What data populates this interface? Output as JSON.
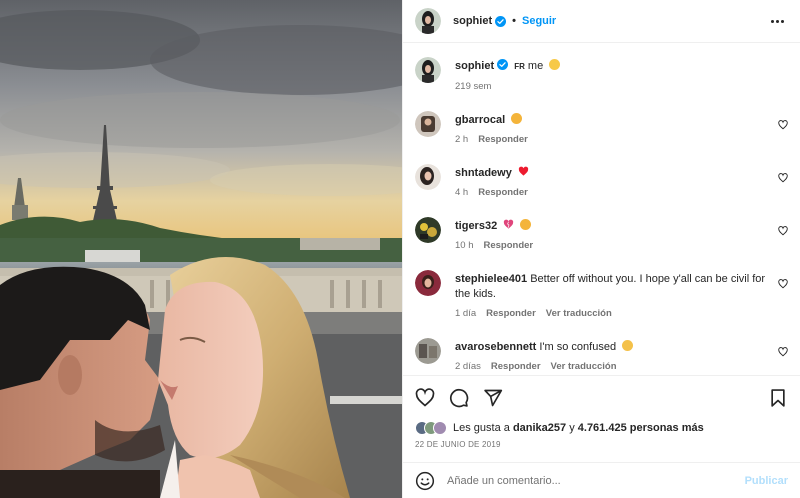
{
  "post": {
    "author": "sophiet",
    "follow_label": "Seguir",
    "dot": "•",
    "caption_flag": "FR",
    "caption_text": "me",
    "caption_time": "219 sem"
  },
  "comments": [
    {
      "user": "gbarrocal",
      "text": "",
      "time": "2 h",
      "reply": "Responder",
      "translate": ""
    },
    {
      "user": "shntadewy",
      "text": "",
      "time": "4 h",
      "reply": "Responder",
      "translate": ""
    },
    {
      "user": "tigers32",
      "text": "",
      "time": "10 h",
      "reply": "Responder",
      "translate": ""
    },
    {
      "user": "stephielee401",
      "text": "Better off without you. I hope y'all can be civil for the kids.",
      "time": "1 día",
      "reply": "Responder",
      "translate": "Ver traducción"
    },
    {
      "user": "avarosebennett",
      "text": "I'm so confused",
      "time": "2 días",
      "reply": "Responder",
      "translate": "Ver traducción"
    }
  ],
  "likes": {
    "prefix": "Les gusta a",
    "user": "danika257",
    "connector": "y",
    "others": "4.761.425 personas más"
  },
  "date": "22 DE JUNIO DE 2019",
  "composer": {
    "placeholder": "Añade un comentario...",
    "publish_label": "Publicar"
  },
  "icons": {
    "more": "more-horizontal-icon",
    "like": "heart-outline-icon",
    "comment": "comment-bubble-icon",
    "share": "paper-plane-icon",
    "save": "bookmark-icon",
    "emoji": "smiley-face-icon",
    "verified": "verified-badge-icon"
  },
  "colors": {
    "accent": "#0095f6",
    "publish_disabled": "#b2dffc",
    "text": "#262626",
    "muted": "#737373",
    "divider": "#efefef"
  }
}
